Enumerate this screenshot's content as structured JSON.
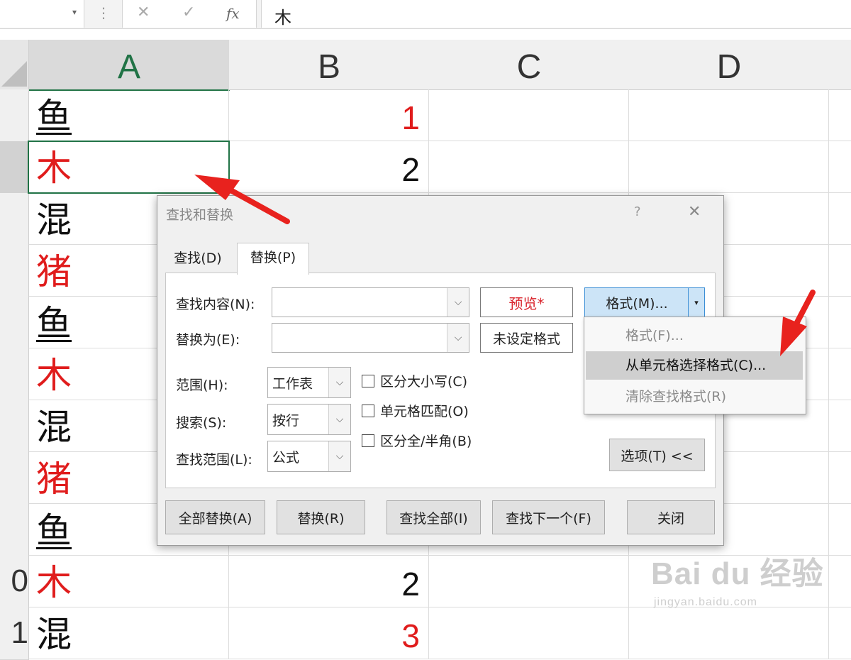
{
  "formula_bar": {
    "fx_label": "fx",
    "cancel_glyph": "✕",
    "enter_glyph": "✓",
    "content": "木"
  },
  "columns": [
    "A",
    "B",
    "C",
    "D"
  ],
  "rows": [
    {
      "row_label": "",
      "a": "鱼",
      "a_color": "black",
      "a_underline": true,
      "b": "1",
      "b_color": "red"
    },
    {
      "row_label": "",
      "a": "木",
      "a_color": "red",
      "a_underline": false,
      "b": "2",
      "b_color": "black"
    },
    {
      "row_label": "",
      "a": "混",
      "a_color": "black",
      "a_underline": false,
      "b": "",
      "b_color": "black"
    },
    {
      "row_label": "",
      "a": "猪",
      "a_color": "red",
      "a_underline": false,
      "b": "",
      "b_color": "black"
    },
    {
      "row_label": "",
      "a": "鱼",
      "a_color": "black",
      "a_underline": true,
      "b": "",
      "b_color": "black"
    },
    {
      "row_label": "",
      "a": "木",
      "a_color": "red",
      "a_underline": false,
      "b": "",
      "b_color": "black"
    },
    {
      "row_label": "",
      "a": "混",
      "a_color": "black",
      "a_underline": false,
      "b": "",
      "b_color": "black"
    },
    {
      "row_label": "",
      "a": "猪",
      "a_color": "red",
      "a_underline": false,
      "b": "",
      "b_color": "black"
    },
    {
      "row_label": "",
      "a": "鱼",
      "a_color": "black",
      "a_underline": true,
      "b": "",
      "b_color": "black"
    },
    {
      "row_label": "0",
      "a": "木",
      "a_color": "red",
      "a_underline": false,
      "b": "2",
      "b_color": "black"
    },
    {
      "row_label": "1",
      "a": "混",
      "a_color": "black",
      "a_underline": false,
      "b": "3",
      "b_color": "red"
    }
  ],
  "dialog": {
    "title": "查找和替换",
    "help": "?",
    "close": "✕",
    "tabs": [
      "查找(D)",
      "替换(P)"
    ],
    "find_label": "查找内容(N):",
    "find_value": "",
    "replace_label": "替换为(E):",
    "replace_value": "",
    "preview_label": "预览*",
    "no_format_label": "未设定格式",
    "format_button": "格式(M)...",
    "scope_label": "范围(H):",
    "scope_value": "工作表",
    "search_label": "搜索(S):",
    "search_value": "按行",
    "lookin_label": "查找范围(L):",
    "lookin_value": "公式",
    "match_case": "区分大小写(C)",
    "match_entire": "单元格匹配(O)",
    "match_byte": "区分全/半角(B)",
    "options_button": "选项(T) <<",
    "replace_all": "全部替换(A)",
    "replace": "替换(R)",
    "find_all": "查找全部(I)",
    "find_next": "查找下一个(F)",
    "close_button": "关闭"
  },
  "format_menu": {
    "items": [
      "格式(F)...",
      "从单元格选择格式(C)...",
      "清除查找格式(R)"
    ]
  },
  "watermark": {
    "brand": "Bai du 经验",
    "url": "jingyan.baidu.com"
  },
  "colors": {
    "red": "#e01c1c",
    "excel_green": "#217346",
    "arrow": "#e8221e"
  }
}
